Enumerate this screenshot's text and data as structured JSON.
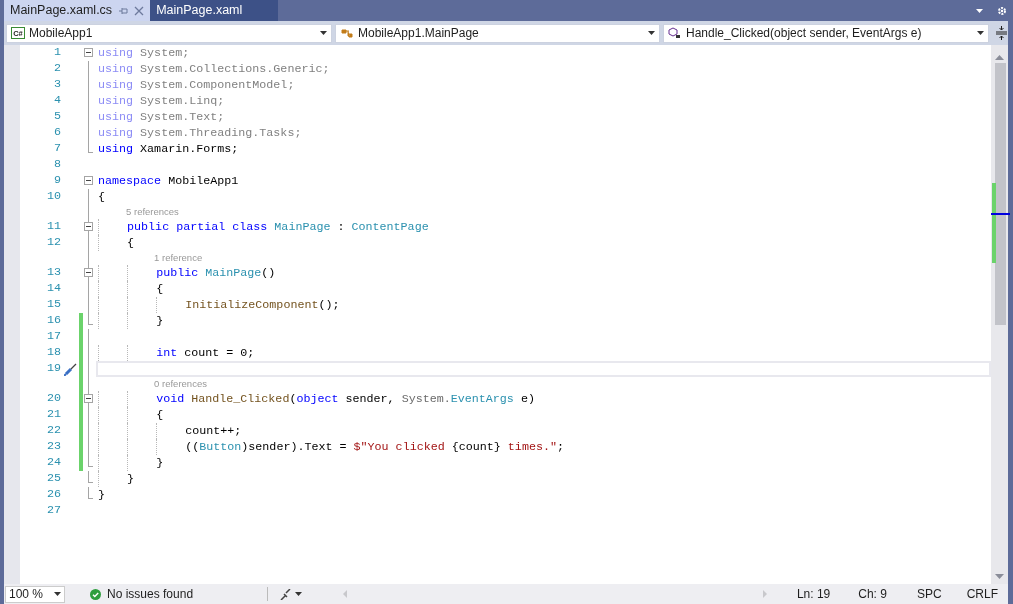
{
  "tabs": [
    {
      "label": "MainPage.xaml.cs",
      "selected": true
    },
    {
      "label": "MainPage.xaml",
      "selected": false
    }
  ],
  "navigation": [
    {
      "kind": "project",
      "icon_text": "C#",
      "text": "MobileApp1"
    },
    {
      "kind": "class",
      "text": "MobileApp1.MainPage"
    },
    {
      "kind": "method",
      "text": "Handle_Clicked(object sender, EventArgs e)"
    }
  ],
  "lines": [
    {
      "number": "1",
      "collapsible": true,
      "in_block": false,
      "block_end": false,
      "changed": false,
      "current": false,
      "tokens": [
        {
          "kind": "keyword_faded",
          "text": "using"
        },
        {
          "kind": "faded",
          "text": " System;"
        }
      ]
    },
    {
      "number": "2",
      "collapsible": false,
      "in_block": true,
      "block_end": false,
      "changed": false,
      "current": false,
      "tokens": [
        {
          "kind": "keyword_faded",
          "text": "using"
        },
        {
          "kind": "faded",
          "text": " System.Collections.Generic;"
        }
      ]
    },
    {
      "number": "3",
      "collapsible": false,
      "in_block": true,
      "block_end": false,
      "changed": false,
      "current": false,
      "tokens": [
        {
          "kind": "keyword_faded",
          "text": "using"
        },
        {
          "kind": "faded",
          "text": " System.ComponentModel;"
        }
      ]
    },
    {
      "number": "4",
      "collapsible": false,
      "in_block": true,
      "block_end": false,
      "changed": false,
      "current": false,
      "tokens": [
        {
          "kind": "keyword_faded",
          "text": "using"
        },
        {
          "kind": "faded",
          "text": " System.Linq;"
        }
      ]
    },
    {
      "number": "5",
      "collapsible": false,
      "in_block": true,
      "block_end": false,
      "changed": false,
      "current": false,
      "tokens": [
        {
          "kind": "keyword_faded",
          "text": "using"
        },
        {
          "kind": "faded",
          "text": " System.Text;"
        }
      ]
    },
    {
      "number": "6",
      "collapsible": false,
      "in_block": true,
      "block_end": false,
      "changed": false,
      "current": false,
      "tokens": [
        {
          "kind": "keyword_faded",
          "text": "using"
        },
        {
          "kind": "faded",
          "text": " System.Threading.Tasks;"
        }
      ]
    },
    {
      "number": "7",
      "collapsible": false,
      "in_block": true,
      "block_end": true,
      "changed": false,
      "current": false,
      "tokens": [
        {
          "kind": "keyword",
          "text": "using"
        },
        {
          "kind": "plain",
          "text": " Xamarin.Forms;"
        }
      ]
    },
    {
      "number": "8",
      "collapsible": false,
      "in_block": false,
      "block_end": false,
      "changed": false,
      "current": false
    },
    {
      "number": "9",
      "collapsible": true,
      "in_block": false,
      "block_end": false,
      "changed": false,
      "current": false,
      "tokens": [
        {
          "kind": "keyword",
          "text": "namespace"
        },
        {
          "kind": "plain",
          "text": " MobileApp1"
        }
      ]
    },
    {
      "number": "10",
      "collapsible": false,
      "in_block": true,
      "block_end": false,
      "changed": false,
      "current": false,
      "tokens": [
        {
          "kind": "plain",
          "text": "{"
        }
      ]
    },
    {
      "number": "11",
      "collapsible": true,
      "in_block": true,
      "block_end": false,
      "changed": false,
      "current": false,
      "codelens": "5 references",
      "tokens": [
        {
          "kind": "keyword",
          "text": "    public partial class "
        },
        {
          "kind": "type",
          "text": "MainPage"
        },
        {
          "kind": "plain",
          "text": " : "
        },
        {
          "kind": "type",
          "text": "ContentPage"
        }
      ]
    },
    {
      "number": "12",
      "collapsible": false,
      "in_block": true,
      "block_end": false,
      "changed": false,
      "current": false,
      "tokens": [
        {
          "kind": "plain",
          "text": "    {"
        }
      ]
    },
    {
      "number": "13",
      "collapsible": true,
      "in_block": true,
      "block_end": false,
      "changed": false,
      "current": false,
      "codelens": "1 reference",
      "tokens": [
        {
          "kind": "keyword",
          "text": "        public "
        },
        {
          "kind": "type",
          "text": "MainPage"
        },
        {
          "kind": "plain",
          "text": "()"
        }
      ]
    },
    {
      "number": "14",
      "collapsible": false,
      "in_block": true,
      "block_end": false,
      "changed": false,
      "current": false,
      "tokens": [
        {
          "kind": "plain",
          "text": "        {"
        }
      ]
    },
    {
      "number": "15",
      "collapsible": false,
      "in_block": true,
      "block_end": false,
      "changed": false,
      "current": false,
      "tokens": [
        {
          "kind": "method",
          "text": "            InitializeComponent"
        },
        {
          "kind": "plain",
          "text": "();"
        }
      ]
    },
    {
      "number": "16",
      "collapsible": false,
      "in_block": true,
      "block_end": true,
      "changed": true,
      "current": false,
      "tokens": [
        {
          "kind": "plain",
          "text": "        }"
        }
      ]
    },
    {
      "number": "17",
      "collapsible": false,
      "in_block": true,
      "block_end": false,
      "changed": true,
      "current": false
    },
    {
      "number": "18",
      "collapsible": false,
      "in_block": true,
      "block_end": false,
      "changed": true,
      "current": false,
      "tokens": [
        {
          "kind": "keyword",
          "text": "        int"
        },
        {
          "kind": "plain",
          "text": " count = 0;"
        }
      ]
    },
    {
      "number": "19",
      "collapsible": false,
      "in_block": true,
      "block_end": false,
      "changed": true,
      "current": true
    },
    {
      "number": "20",
      "collapsible": true,
      "in_block": true,
      "block_end": false,
      "changed": true,
      "current": false,
      "codelens": "0 references",
      "tokens": [
        {
          "kind": "keyword",
          "text": "        void "
        },
        {
          "kind": "method",
          "text": "Handle_Clicked"
        },
        {
          "kind": "plain",
          "text": "("
        },
        {
          "kind": "keyword",
          "text": "object"
        },
        {
          "kind": "plain",
          "text": " sender, "
        },
        {
          "kind": "namespace",
          "text": "System."
        },
        {
          "kind": "type",
          "text": "EventArgs"
        },
        {
          "kind": "plain",
          "text": " e)"
        }
      ]
    },
    {
      "number": "21",
      "collapsible": false,
      "in_block": true,
      "block_end": false,
      "changed": true,
      "current": false,
      "tokens": [
        {
          "kind": "plain",
          "text": "        {"
        }
      ]
    },
    {
      "number": "22",
      "collapsible": false,
      "in_block": true,
      "block_end": false,
      "changed": true,
      "current": false,
      "tokens": [
        {
          "kind": "plain",
          "text": "            count++;"
        }
      ]
    },
    {
      "number": "23",
      "collapsible": false,
      "in_block": true,
      "block_end": false,
      "changed": true,
      "current": false,
      "tokens": [
        {
          "kind": "plain",
          "text": "            (("
        },
        {
          "kind": "type",
          "text": "Button"
        },
        {
          "kind": "plain",
          "text": ")sender).Text = "
        },
        {
          "kind": "string",
          "text": "$\"You clicked "
        },
        {
          "kind": "plain",
          "text": "{count}"
        },
        {
          "kind": "string",
          "text": " times.\""
        },
        {
          "kind": "plain",
          "text": ";"
        }
      ]
    },
    {
      "number": "24",
      "collapsible": false,
      "in_block": true,
      "block_end": true,
      "changed": true,
      "current": false,
      "tokens": [
        {
          "kind": "plain",
          "text": "        }"
        }
      ]
    },
    {
      "number": "25",
      "collapsible": false,
      "in_block": true,
      "block_end": true,
      "changed": false,
      "current": false,
      "tokens": [
        {
          "kind": "plain",
          "text": "    }"
        }
      ]
    },
    {
      "number": "26",
      "collapsible": false,
      "in_block": true,
      "block_end": true,
      "changed": false,
      "current": false,
      "tokens": [
        {
          "kind": "plain",
          "text": "}"
        }
      ]
    },
    {
      "number": "27",
      "collapsible": false,
      "in_block": false,
      "block_end": false,
      "changed": false,
      "current": false
    }
  ],
  "status_bar": {
    "zoom": "100 %",
    "issues": "No issues found",
    "line": "Ln: 19",
    "column": "Ch: 9",
    "indentation": "SPC",
    "line_ending": "CRLF"
  }
}
